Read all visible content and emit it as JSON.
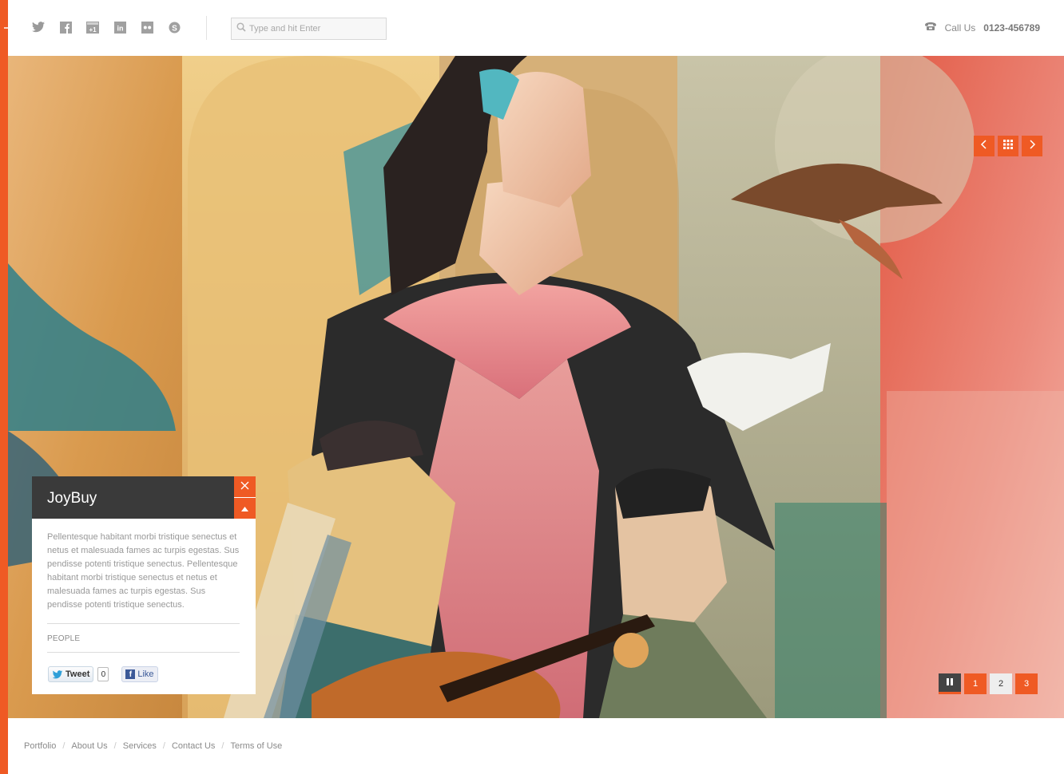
{
  "header": {
    "social_icons": [
      "twitter-icon",
      "facebook-icon",
      "google-plus-icon",
      "linkedin-icon",
      "flickr-icon",
      "skype-icon"
    ],
    "search_placeholder": "Type and hit Enter",
    "call_label": "Call Us",
    "phone": "0123-456789"
  },
  "slider": {
    "pages": [
      "1",
      "2",
      "3"
    ],
    "active_page": "2"
  },
  "info_panel": {
    "title": "JoyBuy",
    "body": "Pellentesque habitant morbi tristique senectus et netus et malesuada fames ac turpis egestas. Sus pendisse potenti tristique senectus. Pellentesque habitant morbi tristique senectus et netus et malesuada fames ac turpis egestas. Sus pendisse potenti tristique senectus.",
    "category": "PEOPLE",
    "tweet_label": "Tweet",
    "tweet_count": "0",
    "like_label": "Like"
  },
  "footer": {
    "links": [
      "Portfolio",
      "About Us",
      "Services",
      "Contact Us",
      "Terms of Use"
    ]
  },
  "colors": {
    "accent": "#ef5a24",
    "panel_dark": "#3a3a3a"
  }
}
